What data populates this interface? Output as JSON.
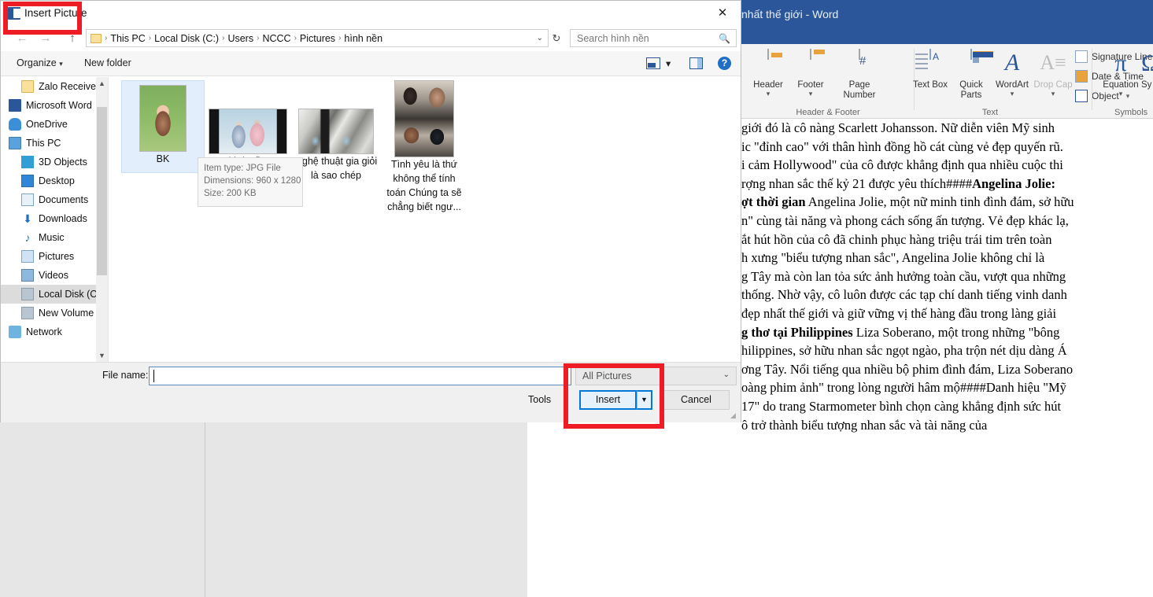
{
  "dialog": {
    "title": "Insert Picture",
    "close_label": "✕",
    "nav": {
      "back": "←",
      "forward": "→",
      "up": "↑"
    },
    "breadcrumbs": [
      "This PC",
      "Local Disk (C:)",
      "Users",
      "NCCC",
      "Pictures",
      "hình nền"
    ],
    "breadcrumb_separator": "›",
    "address_caret": "⌄",
    "refresh_label": "↻",
    "search": {
      "placeholder": "Search hình nền",
      "icon": "search-icon"
    },
    "toolbar": {
      "organize": "Organize",
      "organize_caret": "▾",
      "new_folder": "New folder",
      "view_caret": "▾",
      "help": "?"
    },
    "sidebar": [
      {
        "label": "Zalo Received",
        "icon": "folder-icon",
        "indent": 26,
        "selected": false
      },
      {
        "label": "Microsoft Word",
        "icon": "word-icon",
        "indent": 10,
        "selected": false
      },
      {
        "label": "OneDrive",
        "icon": "cloud-icon",
        "indent": 10,
        "selected": false
      },
      {
        "label": "This PC",
        "icon": "pc-icon",
        "indent": 10,
        "selected": false
      },
      {
        "label": "3D Objects",
        "icon": "3d-objects-icon",
        "indent": 26,
        "selected": false
      },
      {
        "label": "Desktop",
        "icon": "desktop-icon",
        "indent": 26,
        "selected": false
      },
      {
        "label": "Documents",
        "icon": "documents-icon",
        "indent": 26,
        "selected": false
      },
      {
        "label": "Downloads",
        "icon": "downloads-icon",
        "indent": 26,
        "selected": false
      },
      {
        "label": "Music",
        "icon": "music-icon",
        "indent": 26,
        "selected": false
      },
      {
        "label": "Pictures",
        "icon": "pictures-icon",
        "indent": 26,
        "selected": false
      },
      {
        "label": "Videos",
        "icon": "videos-icon",
        "indent": 26,
        "selected": false
      },
      {
        "label": "Local Disk (C:)",
        "icon": "drive-icon",
        "indent": 26,
        "selected": true
      },
      {
        "label": "New Volume",
        "icon": "drive-icon",
        "indent": 26,
        "selected": false
      },
      {
        "label": "Network",
        "icon": "network-icon",
        "indent": 10,
        "selected": false
      }
    ],
    "files": [
      {
        "name": "BK",
        "selected": true
      },
      {
        "name": "hình nền",
        "selected": false
      },
      {
        "name": "Nghệ thuật gia giỏi là sao chép",
        "selected": false
      },
      {
        "name": "Tình yêu là thứ không thể tính toán Chúng ta sẽ chẳng biết ngư...",
        "selected": false
      }
    ],
    "tooltip": {
      "item_type": "Item type: JPG File",
      "dimensions": "Dimensions: 960 x 1280",
      "size": "Size: 200 KB"
    },
    "filename_label": "File name:",
    "filename_value": "",
    "filetype_value": "All Pictures",
    "filetype_caret": "⌄",
    "tools_label": "Tools",
    "insert_label": "Insert",
    "insert_caret": "▼",
    "cancel_label": "Cancel"
  },
  "word": {
    "title": "nhất thế giới - Word",
    "ribbon_groups": [
      {
        "name": "Header & Footer",
        "buttons": [
          {
            "label": "Header",
            "caret": "▾",
            "icon": "header-icon"
          },
          {
            "label": "Footer",
            "caret": "▾",
            "icon": "footer-icon"
          },
          {
            "label": "Page Number",
            "caret": "▾",
            "icon": "page-number-icon"
          }
        ]
      },
      {
        "name": "Text",
        "buttons": [
          {
            "label": "Text Box",
            "caret": "▾",
            "icon": "text-box-icon"
          },
          {
            "label": "Quick Parts",
            "caret": "▾",
            "icon": "quick-parts-icon"
          },
          {
            "label": "WordArt",
            "caret": "▾",
            "icon": "wordart-icon"
          },
          {
            "label": "Drop Cap",
            "caret": "▾",
            "icon": "drop-cap-icon"
          }
        ],
        "small_buttons": [
          {
            "label": "Signature Line",
            "caret": "▾",
            "icon": "signature-line-icon"
          },
          {
            "label": "Date & Time",
            "caret": "",
            "icon": "date-time-icon"
          },
          {
            "label": "Object",
            "caret": "▾",
            "icon": "object-icon"
          }
        ]
      },
      {
        "name": "Symbols",
        "buttons": [
          {
            "label": "Equation",
            "caret": "▾",
            "icon": "equation-icon"
          },
          {
            "label": "Sy",
            "caret": "",
            "icon": "symbol-icon"
          }
        ]
      }
    ],
    "document_lines": [
      {
        "text": "giới đó là cô nàng Scarlett Johansson. Nữ diễn viên Mỹ sinh",
        "bold_prefix": ""
      },
      {
        "text": "ic \"đỉnh cao\" với thân hình đồng hồ cát cùng vẻ đẹp quyến rũ.",
        "bold_prefix": ""
      },
      {
        "text": "i cảm Hollywood\" của cô được khẳng định qua nhiều cuộc thi",
        "bold_prefix": ""
      },
      {
        "text": "rợng nhan sắc thế kỷ 21 được yêu thích####",
        "bold_prefix": "",
        "bold_suffix": "Angelina Jolie:"
      },
      {
        "text": " Angelina Jolie, một nữ minh tinh đình đám, sở hữu",
        "bold_prefix": "ợt thời gian"
      },
      {
        "text": "n\" cùng tài năng và phong cách sống ấn tượng. Vẻ đẹp khác lạ,",
        "bold_prefix": ""
      },
      {
        "text": "ắt hút hồn của cô đã chinh phục hàng triệu trái tim trên toàn",
        "bold_prefix": ""
      },
      {
        "text": "h xưng \"biểu tượng nhan sắc\", Angelina Jolie không chỉ là",
        "bold_prefix": ""
      },
      {
        "text": "g Tây mà còn lan tỏa sức ảnh hưởng toàn cầu, vượt qua những",
        "bold_prefix": ""
      },
      {
        "text": "thống. Nhờ vậy, cô luôn được các tạp chí danh tiếng vinh danh",
        "bold_prefix": ""
      },
      {
        "text": "đẹp nhất thế giới và giữ vững vị thế hàng đầu trong làng giải",
        "bold_prefix": ""
      },
      {
        "text": " Liza Soberano, một trong những \"bông",
        "bold_prefix": "g thơ tại Philippines"
      },
      {
        "text": "hilippines, sở hữu nhan sắc ngọt ngào, pha trộn nét dịu dàng Á",
        "bold_prefix": ""
      },
      {
        "text": "ơng Tây. Nổi tiếng qua nhiều bộ phim đình đám, Liza Soberano",
        "bold_prefix": ""
      },
      {
        "text": "oàng phim ảnh\" trong lòng người hâm mộ####Danh hiệu \"Mỹ",
        "bold_prefix": ""
      },
      {
        "text": "17\" do trang Starmometer bình chọn càng khẳng định sức hút",
        "bold_prefix": ""
      },
      {
        "text": "ô trở thành biểu tượng nhan sắc và tài năng của",
        "bold_prefix": ""
      }
    ]
  },
  "annotations": {
    "color": "#ee1c24",
    "boxes": [
      {
        "name": "insert-picture-title-highlight"
      },
      {
        "name": "insert-button-highlight"
      }
    ]
  }
}
